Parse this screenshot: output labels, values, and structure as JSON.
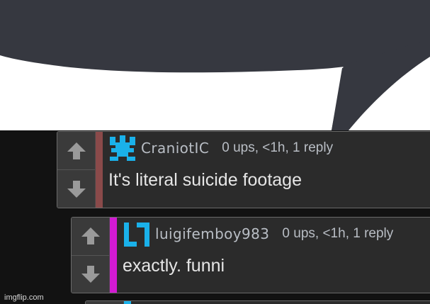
{
  "comments": [
    {
      "username": "CraniotIC",
      "meta": "0 ups, <1h, 1 reply",
      "text": "It's literal suicide footage",
      "bar_color": "#8a4a4a",
      "avatar_color": "#1ab1ea",
      "upvote_icon": "up-arrow-icon",
      "downvote_icon": "down-arrow-icon"
    },
    {
      "username": "luigifemboy983",
      "meta": "0 ups, <1h, 1 reply",
      "text": "exactly. funni",
      "bar_color": "#d21ad2",
      "avatar_color": "#1ab1ea",
      "upvote_icon": "up-arrow-icon",
      "downvote_icon": "down-arrow-icon"
    }
  ],
  "watermark": "imgflip.com",
  "colors": {
    "bubble": "#363840",
    "comment_bg": "#2b2b2b",
    "page_bg": "#121212"
  }
}
